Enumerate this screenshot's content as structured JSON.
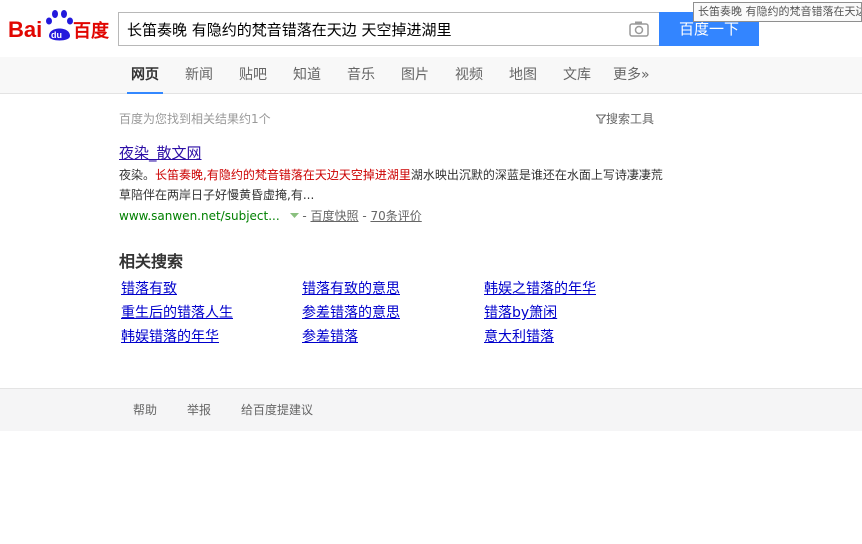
{
  "header": {
    "logo_alt": "Baidu百度",
    "search_query": "长笛奏晚 有隐约的梵音错落在天边 天空掉进湖里",
    "search_button": "百度一下",
    "tooltip": "长笛奏晚 有隐约的梵音错落在天边"
  },
  "nav": {
    "tabs": [
      {
        "label": "网页",
        "active": true
      },
      {
        "label": "新闻"
      },
      {
        "label": "贴吧"
      },
      {
        "label": "知道"
      },
      {
        "label": "音乐"
      },
      {
        "label": "图片"
      },
      {
        "label": "视频"
      },
      {
        "label": "地图"
      },
      {
        "label": "文库"
      },
      {
        "label": "更多»"
      }
    ]
  },
  "results": {
    "count_text": "百度为您找到相关结果约1个",
    "tools_label": "搜索工具",
    "items": [
      {
        "title": "夜染_散文网",
        "abstract_prefix": "夜染。",
        "abstract_highlight": "长笛奏晚,有隐约的梵音错落在天边天空掉进湖里",
        "abstract_rest": "湖水映出沉默的深蓝是谁还在水面上写诗凄凄荒草陪伴在两岸日子好慢黄昏虚掩,有...",
        "url": "www.sanwen.net/subject...",
        "snapshot_label": "百度快照",
        "reviews_label": "70条评价"
      }
    ]
  },
  "related": {
    "title": "相关搜索",
    "links": [
      "错落有致",
      "错落有致的意思",
      "韩娱之错落的年华",
      "重生后的错落人生",
      "参差错落的意思",
      "错落by箫闲",
      "韩娱错落的年华",
      "参差错落",
      "意大利错落"
    ]
  },
  "footer": {
    "links": [
      "帮助",
      "举报",
      "给百度提建议"
    ]
  },
  "colors": {
    "accent": "#3385ff",
    "highlight": "#cc0000",
    "url_green": "#008000",
    "link_blue": "#0000cc"
  }
}
